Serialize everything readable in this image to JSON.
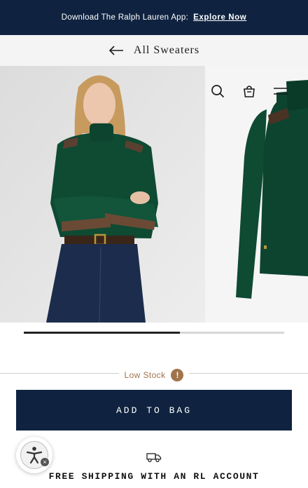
{
  "promo": {
    "text": "Download The Ralph Lauren App:",
    "link": "Explore Now"
  },
  "nav": {
    "back_icon": "arrow-left-icon",
    "title": "All Sweaters"
  },
  "gallery": {
    "icons": [
      "search-icon",
      "shopping-bag-icon",
      "menu-icon"
    ],
    "progress_fraction": 0.6,
    "colors": {
      "sweater": "#0f4a33",
      "denim": "#1c2c4c",
      "suede": "#6b4a35"
    }
  },
  "stock": {
    "label": "Low Stock",
    "badge": "!"
  },
  "cta": {
    "add_to_bag": "ADD TO BAG"
  },
  "accessibility": {
    "icon": "accessibility-icon",
    "close": "×"
  },
  "shipping": {
    "icon": "truck-icon",
    "text": "FREE SHIPPING WITH AN RL ACCOUNT"
  },
  "colors": {
    "navy": "#0f2340",
    "accent_brown": "#a0734a"
  }
}
